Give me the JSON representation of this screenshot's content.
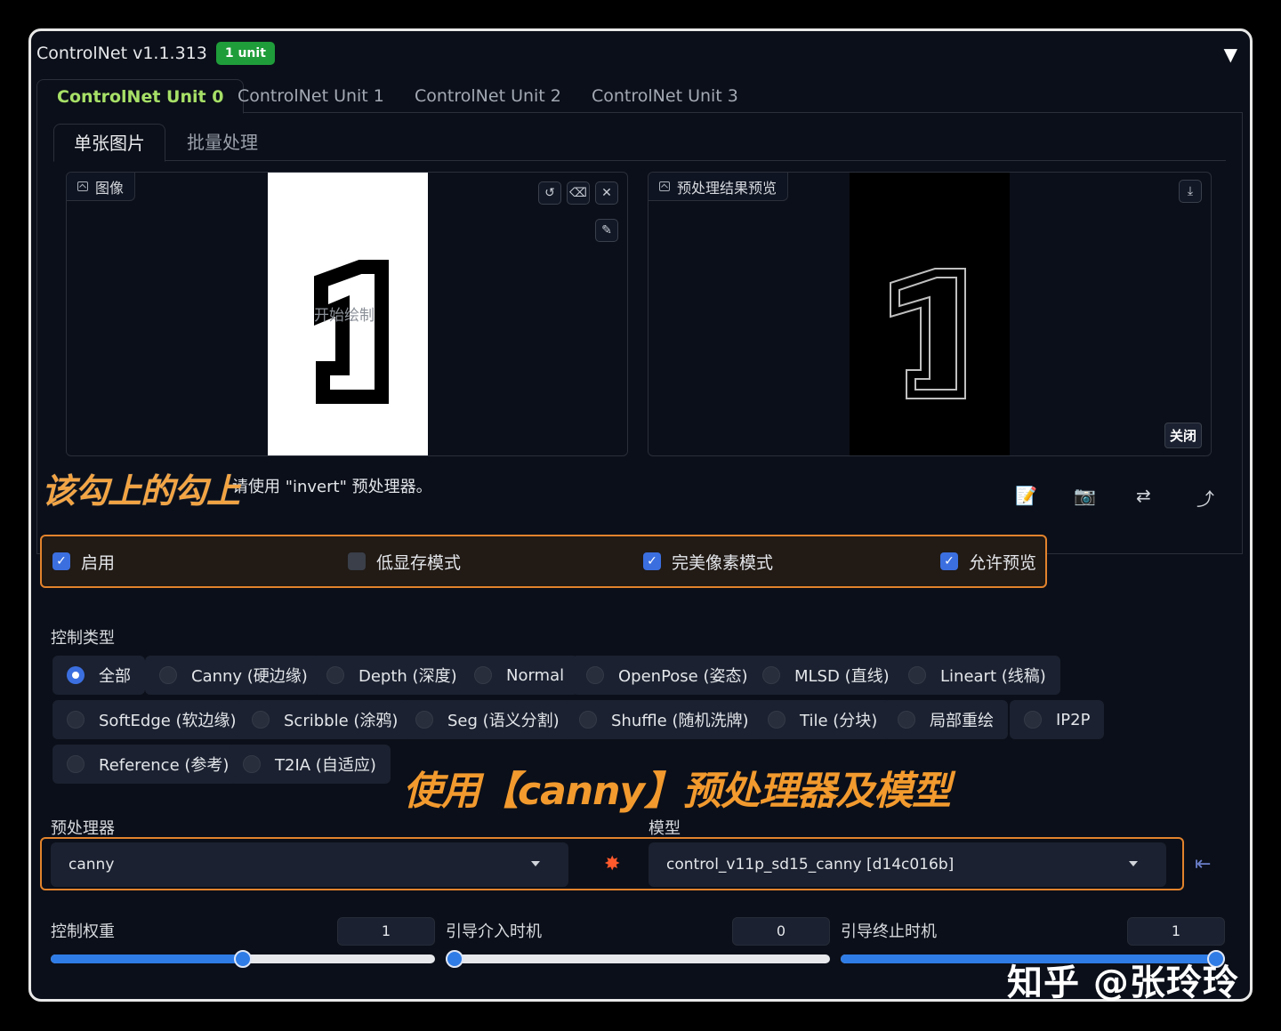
{
  "header": {
    "title": "ControlNet v1.1.313",
    "badge": "1 unit",
    "collapse_icon": "▼"
  },
  "unit_tabs": [
    "ControlNet Unit 0",
    "ControlNet Unit 1",
    "ControlNet Unit 2",
    "ControlNet Unit 3"
  ],
  "mode_tabs": [
    "单张图片",
    "批量处理"
  ],
  "image_panel": {
    "label": "图像",
    "draw_hint": "开始绘制",
    "digit": "1"
  },
  "preview_panel": {
    "label": "预处理结果预览",
    "close": "关闭",
    "digit": "1"
  },
  "note_text": "请使用 \"invert\" 预处理器。",
  "annotations": {
    "check": "该勾上的勾上",
    "canny": "使用【canny】预处理器及模型"
  },
  "options": [
    {
      "label": "启用",
      "checked": true
    },
    {
      "label": "低显存模式",
      "checked": false
    },
    {
      "label": "完美像素模式",
      "checked": true
    },
    {
      "label": "允许预览",
      "checked": true
    }
  ],
  "control_type": {
    "label": "控制类型",
    "items": [
      "全部",
      "Canny (硬边缘)",
      "Depth (深度)",
      "Normal",
      "OpenPose (姿态)",
      "MLSD (直线)",
      "Lineart (线稿)",
      "SoftEdge (软边缘)",
      "Scribble (涂鸦)",
      "Seg (语义分割)",
      "Shuffle (随机洗牌)",
      "Tile (分块)",
      "局部重绘",
      "IP2P",
      "Reference (参考)",
      "T2IA (自适应)"
    ],
    "selected": "全部"
  },
  "preprocessor": {
    "label": "预处理器",
    "value": "canny"
  },
  "model": {
    "label": "模型",
    "value": "control_v11p_sd15_canny [d14c016b]"
  },
  "sliders": [
    {
      "label": "控制权重",
      "value": "1",
      "fraction": 0.5
    },
    {
      "label": "引导介入时机",
      "value": "0",
      "fraction": 0.0
    },
    {
      "label": "引导终止时机",
      "value": "1",
      "fraction": 1.0
    }
  ],
  "watermark": "知乎 @张玲玲",
  "colors": {
    "accent": "#a7e067",
    "annotation": "#f29a2e",
    "checkbox": "#3b6fe0",
    "slider": "#2f7ce6",
    "badge": "#1f9d3a"
  }
}
